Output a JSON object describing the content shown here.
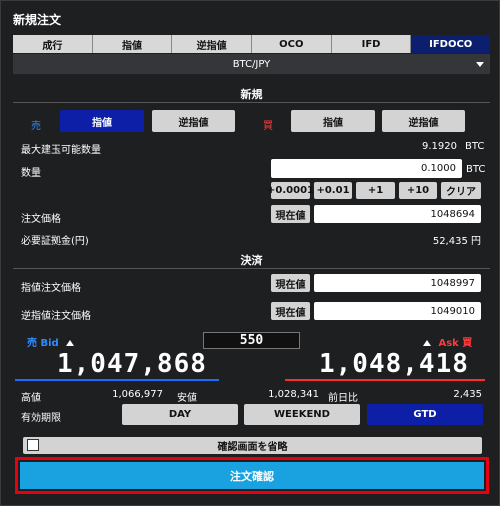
{
  "window_title": "新規注文",
  "tabs": [
    "成行",
    "指値",
    "逆指値",
    "OCO",
    "IFD",
    "IFDOCO"
  ],
  "active_tab": "IFDOCO",
  "symbol": "BTC/JPY",
  "new_section": {
    "heading": "新規",
    "sell_label": "売",
    "buy_label": "買",
    "sell_limit": "指値",
    "sell_stop": "逆指値",
    "buy_limit": "指値",
    "buy_stop": "逆指値",
    "max_qty_label": "最大建玉可能数量",
    "max_qty_value": "9.1920",
    "max_qty_unit": "BTC",
    "qty_label": "数量",
    "qty_value": "0.1000",
    "qty_unit": "BTC",
    "qty_buttons": [
      "+0.0001",
      "+0.01",
      "+1",
      "+10",
      "クリア"
    ],
    "order_price_label": "注文価格",
    "current_price_btn": "現在値",
    "order_price_value": "1048694",
    "margin_label": "必要証拠金(円)",
    "margin_value": "52,435 円"
  },
  "settle_section": {
    "heading": "決済",
    "limit_label": "指値注文価格",
    "limit_btn": "現在値",
    "limit_value": "1048997",
    "stop_label": "逆指値注文価格",
    "stop_btn": "現在値",
    "stop_value": "1049010"
  },
  "quotes": {
    "bid_label": "売 Bid",
    "ask_label": "Ask 買",
    "bid": "1,047,868",
    "ask": "1,048,418",
    "spread": "550",
    "high_label": "高値",
    "high_value": "1,066,977",
    "low_label": "安値",
    "low_value": "1,028,341",
    "change_label": "前日比",
    "change_value": "2,435"
  },
  "validity": {
    "label": "有効期限",
    "options": [
      "DAY",
      "WEEKEND",
      "GTD"
    ],
    "selected": "GTD"
  },
  "skip_confirm_label": "確認画面を省略",
  "submit_label": "注文確認",
  "colors": {
    "accent_blue": "#0c1fa6",
    "sell_blue": "#2f8cff",
    "buy_red": "#ff3b3b",
    "submit_blue": "#1aa2e0",
    "highlight_red": "#e60012"
  }
}
